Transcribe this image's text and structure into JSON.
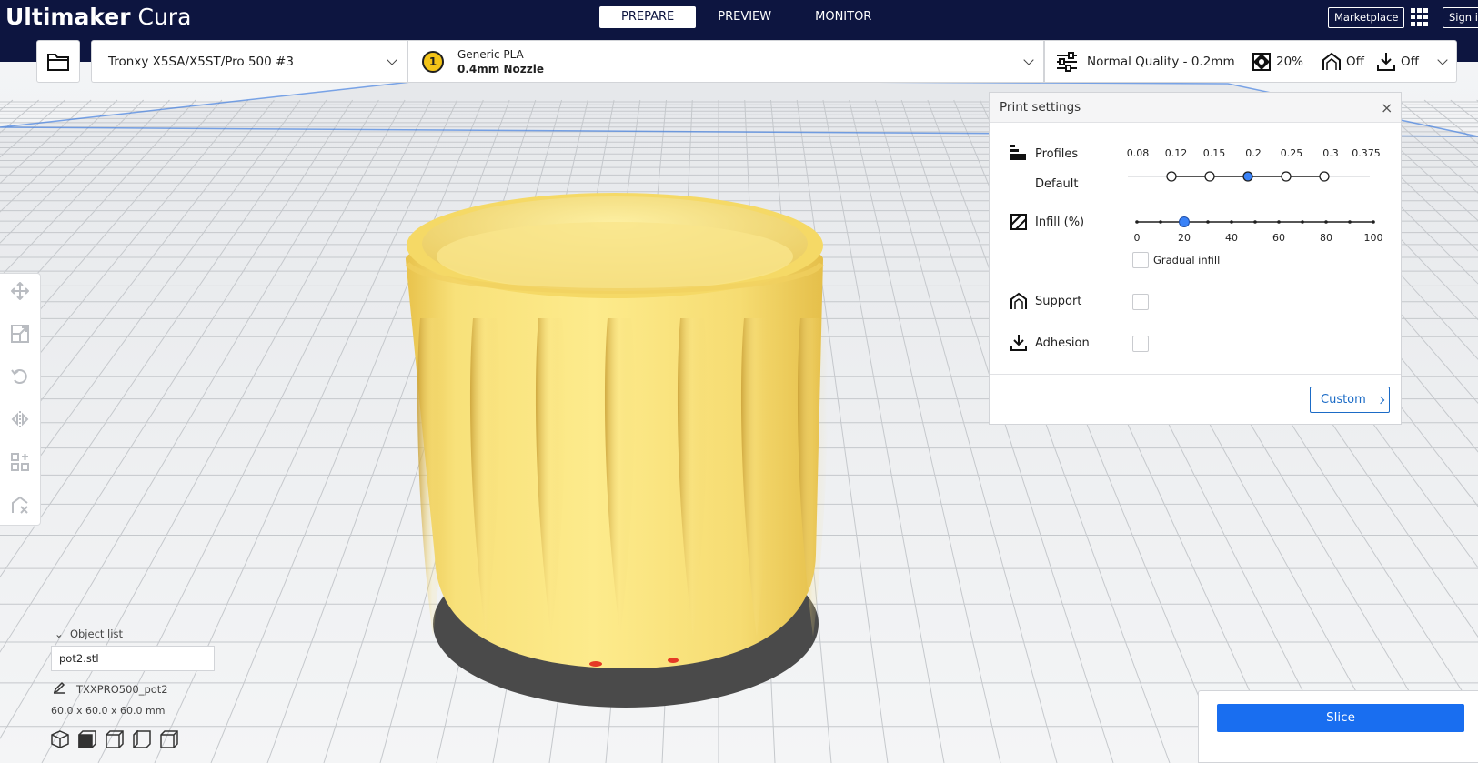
{
  "app": {
    "title_bold": "Ultimaker",
    "title_light": " Cura"
  },
  "stages": [
    {
      "label": "PREPARE",
      "active": true
    },
    {
      "label": "PREVIEW",
      "active": false
    },
    {
      "label": "MONITOR",
      "active": false
    }
  ],
  "header_right": {
    "marketplace": "Marketplace",
    "signin": "Sign in"
  },
  "printer": {
    "name": "Tronxy X5SA/X5ST/Pro 500 #3"
  },
  "extruder": {
    "index": "1",
    "material": "Generic PLA",
    "nozzle": "0.4mm Nozzle",
    "color": "#f3c418"
  },
  "settings_summary": {
    "quality": "Normal Quality - 0.2mm",
    "infill": "20%",
    "support": "Off",
    "adhesion": "Off"
  },
  "print_settings": {
    "title": "Print settings",
    "profiles_label": "Profiles",
    "profile_name": "Default",
    "layer_heights": [
      "0.08",
      "0.12",
      "0.15",
      "0.2",
      "0.25",
      "0.3",
      "0.375"
    ],
    "selected_layer_height": "0.2",
    "infill_label": "Infill (%)",
    "infill_ticks": [
      "0",
      "20",
      "40",
      "60",
      "80",
      "100"
    ],
    "infill_value": 20,
    "gradual_infill_label": "Gradual infill",
    "gradual_infill": false,
    "support_label": "Support",
    "support": false,
    "adhesion_label": "Adhesion",
    "adhesion": false,
    "custom_button": "Custom"
  },
  "object_list": {
    "toggle_label": "Object list",
    "items": [
      "pot2.stl"
    ],
    "object_name": "TXXPRO500_pot2",
    "dimensions": "60.0 x 60.0 x 60.0 mm"
  },
  "action": {
    "slice_label": "Slice"
  },
  "colors": {
    "header": "#0d1540",
    "accent": "#196ef0",
    "model": "#f7df6c",
    "selected_dot": "#3a82f7"
  }
}
